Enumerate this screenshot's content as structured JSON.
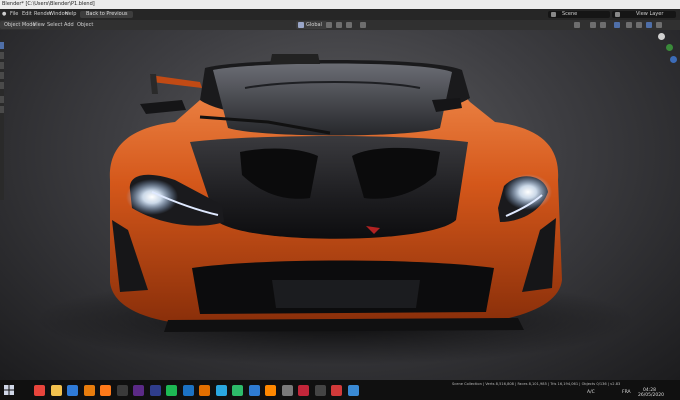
{
  "window": {
    "title": "Blender* [C:\\Users\\Blender\\P1.blend]"
  },
  "menu": {
    "items": [
      "File",
      "Edit",
      "Render",
      "Window",
      "Help"
    ],
    "back_button": "Back to Previous",
    "scene": "Scene",
    "view_layer": "View Layer"
  },
  "header": {
    "mode": "Object Mode",
    "items": [
      "View",
      "Select",
      "Add",
      "Object"
    ],
    "orientation": "Global"
  },
  "viewport": {
    "body_color": "#d4571a",
    "hood_color": "#1f1f21"
  },
  "status": {
    "stats": "Scene Collection | Verts 8,516,808 | Faces 8,101,985 | Tris 16,194,061 | Objects 0/136 | v2.83",
    "lang": "FRA",
    "time": "04:28",
    "date": "26/05/2020",
    "abc": "A/C"
  },
  "taskbar_apps": [
    {
      "name": "chrome-icon",
      "color": "#e8453c"
    },
    {
      "name": "folder-icon",
      "color": "#f2c14e"
    },
    {
      "name": "mail-icon",
      "color": "#2f7bd8"
    },
    {
      "name": "blender-icon",
      "color": "#e87d0d"
    },
    {
      "name": "firefox-icon",
      "color": "#ff7a1a"
    },
    {
      "name": "media-icon",
      "color": "#3a3a3a"
    },
    {
      "name": "premiere-icon",
      "color": "#5b2a86"
    },
    {
      "name": "aftereffects-icon",
      "color": "#2f3d8c"
    },
    {
      "name": "spotify-icon",
      "color": "#1db954"
    },
    {
      "name": "photoshop-icon",
      "color": "#1c72c4"
    },
    {
      "name": "illustrator-icon",
      "color": "#e36f00"
    },
    {
      "name": "browser-icon",
      "color": "#2aa7e0"
    },
    {
      "name": "edge-icon",
      "color": "#2dbb6a"
    },
    {
      "name": "music-icon",
      "color": "#2e7bd1"
    },
    {
      "name": "vlc-icon",
      "color": "#ff8800"
    },
    {
      "name": "app-icon",
      "color": "#7a7a7a"
    },
    {
      "name": "photo-icon",
      "color": "#c2263a"
    },
    {
      "name": "dark-icon",
      "color": "#444444"
    },
    {
      "name": "store-icon",
      "color": "#d23a3a"
    },
    {
      "name": "network-icon",
      "color": "#3a8ad4"
    }
  ]
}
